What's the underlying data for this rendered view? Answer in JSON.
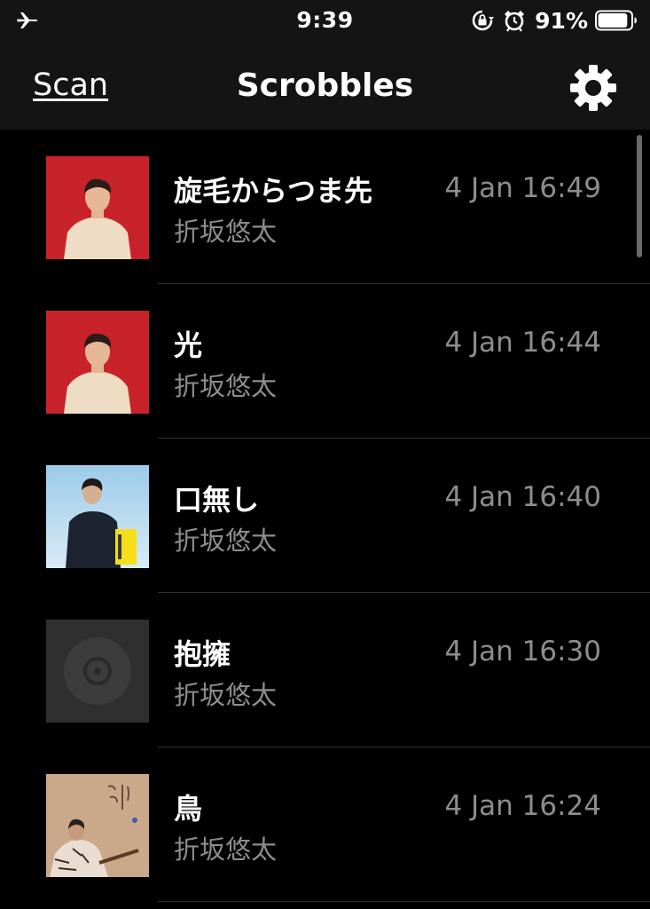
{
  "status_bar": {
    "time": "9:39",
    "battery_percent": "91%",
    "battery_level": 0.91,
    "icons": [
      "airplane-icon",
      "orientation-lock-icon",
      "alarm-icon",
      "battery-icon"
    ]
  },
  "nav": {
    "left_label": "Scan",
    "title": "Scrobbles",
    "right_icon": "gear-icon"
  },
  "scrobbles": [
    {
      "title": "旋毛からつま先",
      "artist": "折坂悠太",
      "time": "4 Jan 16:49",
      "artwork": "red-portrait"
    },
    {
      "title": "光",
      "artist": "折坂悠太",
      "time": "4 Jan 16:44",
      "artwork": "red-portrait"
    },
    {
      "title": "口無し",
      "artist": "折坂悠太",
      "time": "4 Jan 16:40",
      "artwork": "sky-portrait"
    },
    {
      "title": "抱擁",
      "artist": "折坂悠太",
      "time": "4 Jan 16:30",
      "artwork": "placeholder-disc"
    },
    {
      "title": "鳥",
      "artist": "折坂悠太",
      "time": "4 Jan 16:24",
      "artwork": "beige-guitar"
    }
  ],
  "colors": {
    "background": "#000000",
    "bar_background": "#141414",
    "primary_text": "#ffffff",
    "secondary_text": "#8d8d8d",
    "separator": "#2f2f2f"
  }
}
